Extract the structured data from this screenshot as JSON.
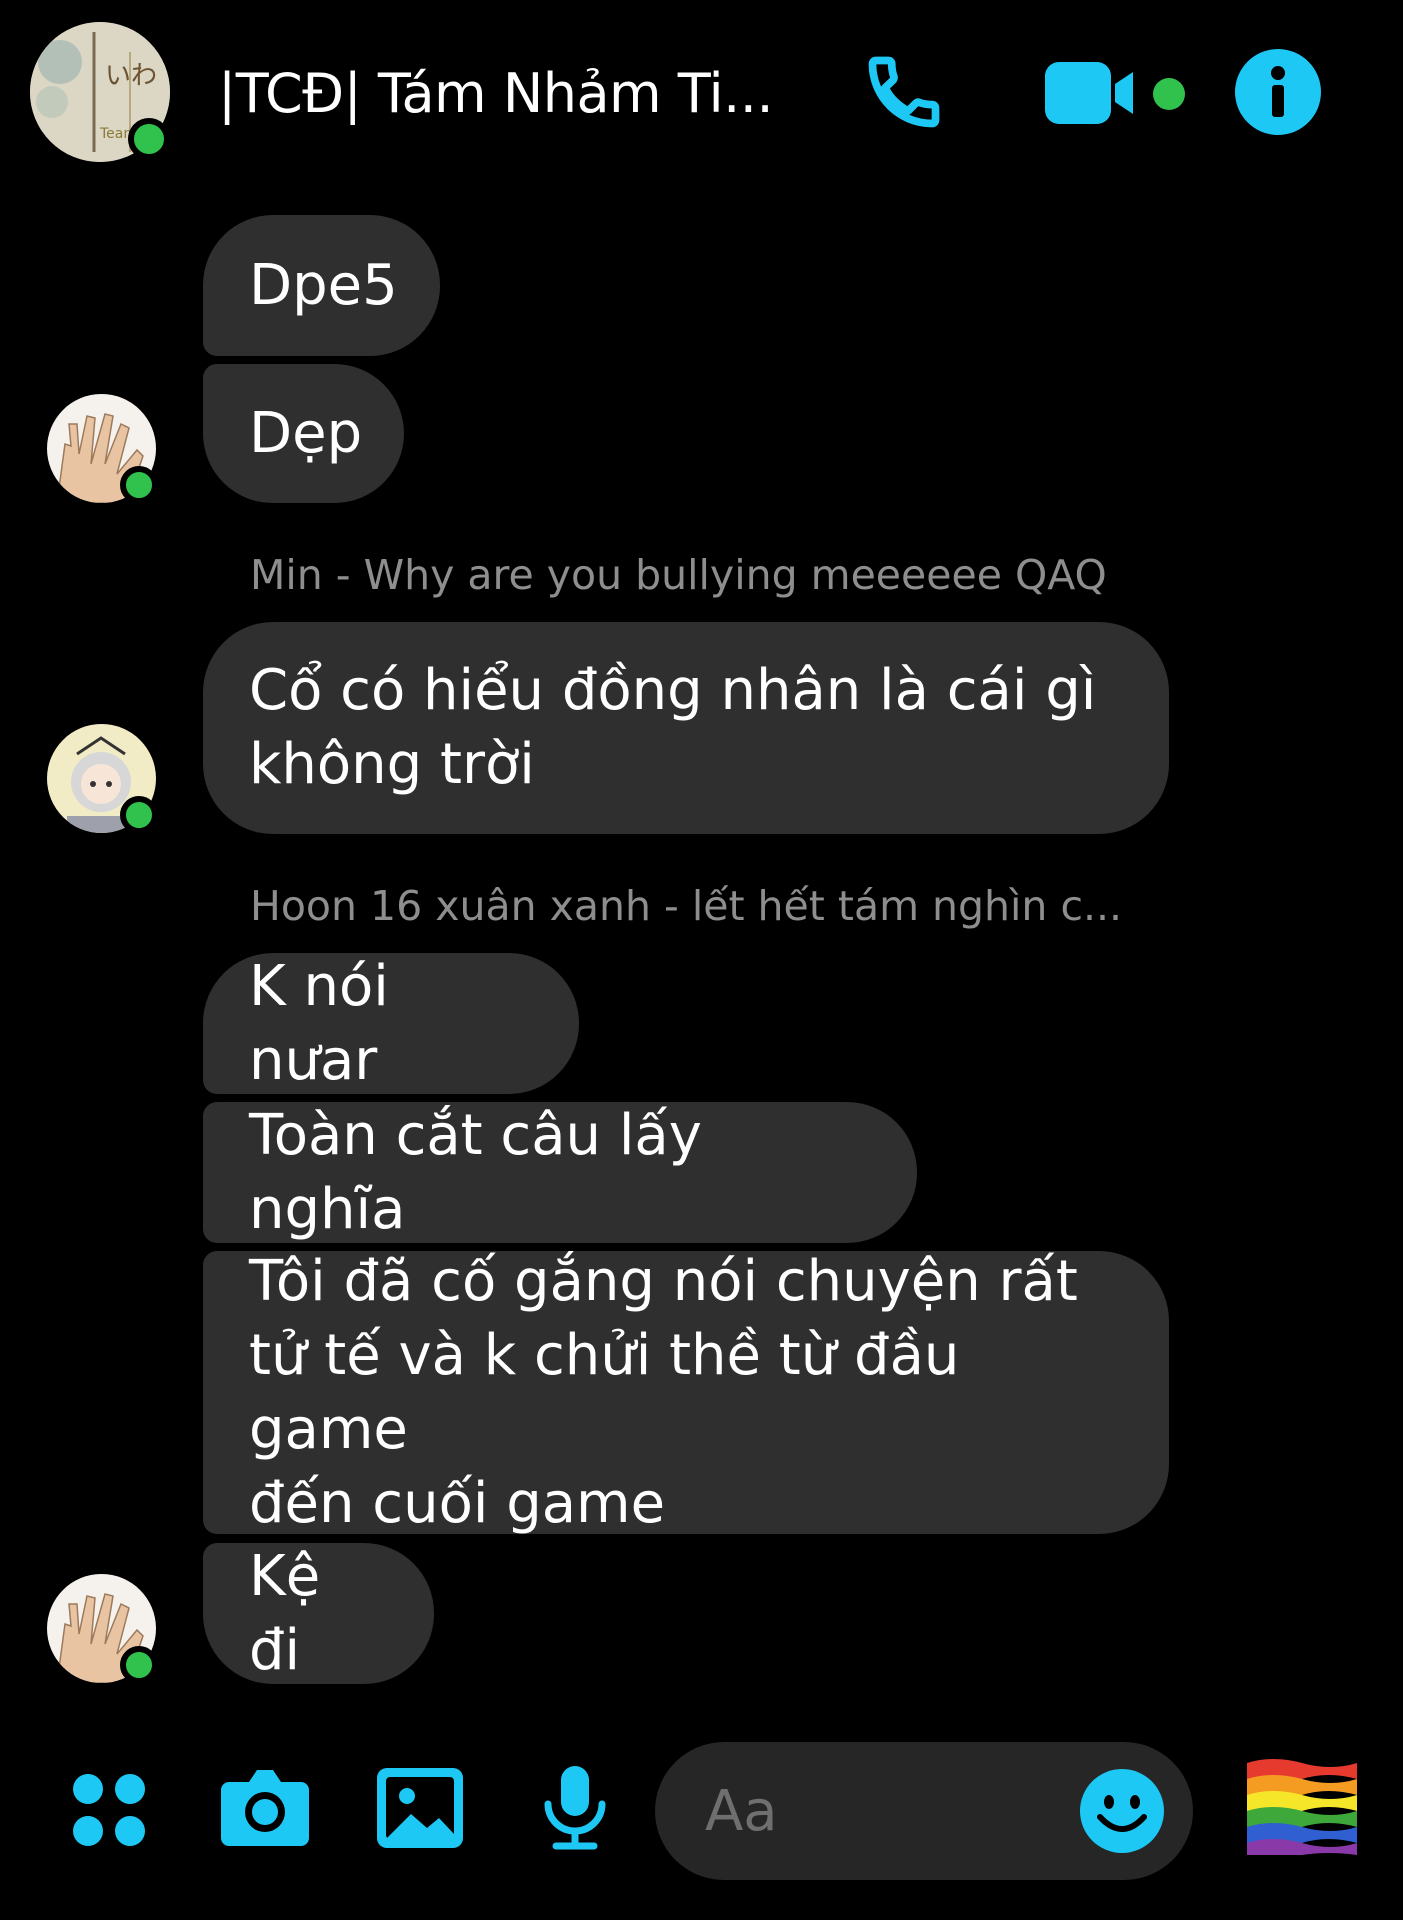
{
  "header": {
    "title": "|TCĐ| Tám Nhảm Ti...",
    "group_avatar_text": "いわ",
    "group_avatar_sub": "Team"
  },
  "messages": [
    {
      "text": "Dpe5"
    },
    {
      "text": "Dẹp"
    },
    {
      "reply_label": "Min - Why are you bullying meeeeee QAQ"
    },
    {
      "text": "Cổ có hiểu đồng nhân là cái gì\nkhông trời"
    },
    {
      "reply_label": "Hoon 16 xuân xanh - lết hết tám nghìn c..."
    },
    {
      "text": "K nói nưar"
    },
    {
      "text": "Toàn cắt câu lấy nghĩa"
    },
    {
      "text": "Tôi đã cố gắng nói chuyện rất\ntử tế và k chửi thề từ đầu game\nđến cuối game"
    },
    {
      "text": "Kệ đi"
    }
  ],
  "composer": {
    "placeholder": "Aa"
  },
  "colors": {
    "accent": "#1ec8f5",
    "online": "#31c24d",
    "bubble": "#2f2f2f",
    "background": "#000000",
    "reply_text": "#8e8e8e"
  },
  "icons": [
    "phone-icon",
    "video-call-icon",
    "info-icon",
    "apps-icon",
    "camera-icon",
    "gallery-icon",
    "microphone-icon",
    "emoji-icon",
    "pride-flag-icon"
  ]
}
